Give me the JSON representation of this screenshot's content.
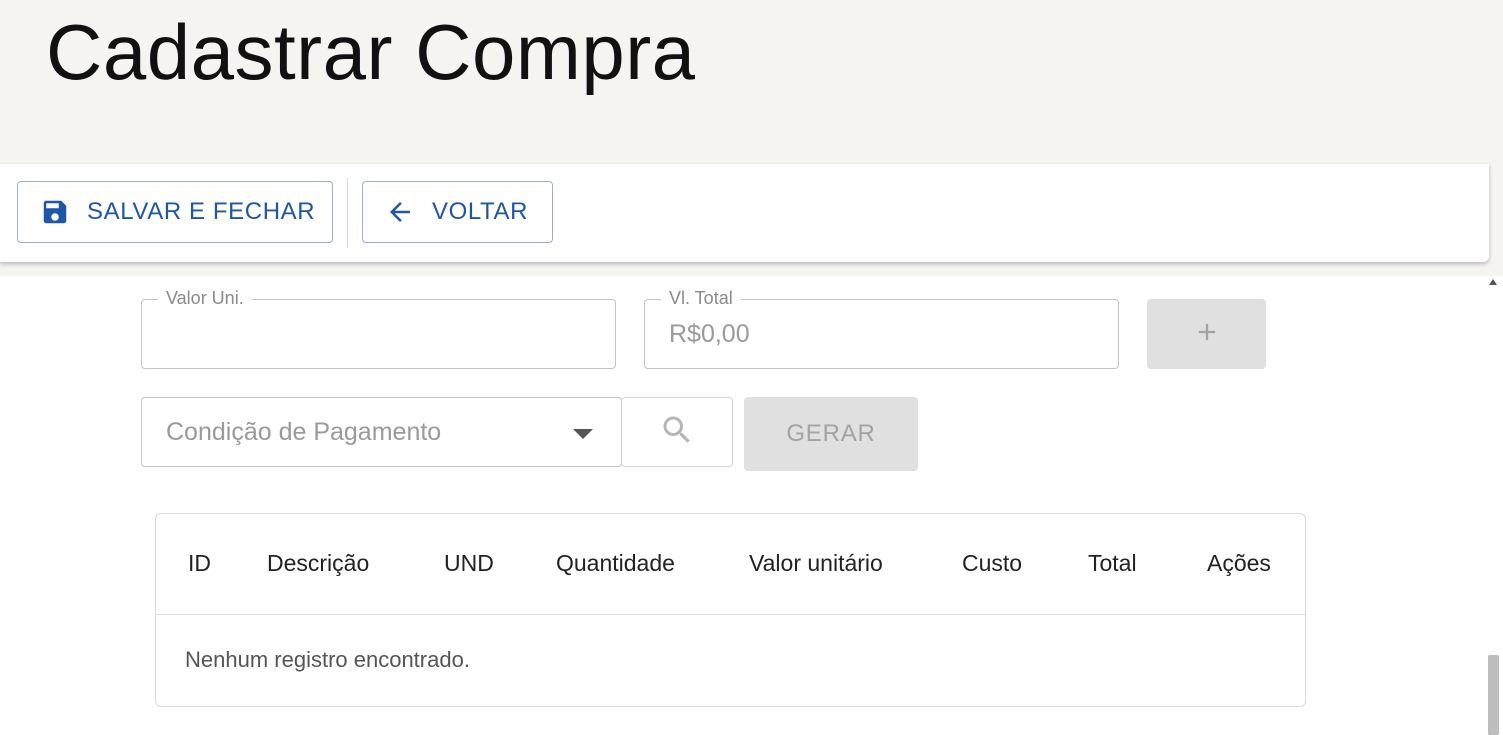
{
  "page": {
    "title": "Cadastrar Compra"
  },
  "toolbar": {
    "save_label": "SALVAR E FECHAR",
    "back_label": "VOLTAR"
  },
  "form": {
    "valor_uni": {
      "label": "Valor Uni.",
      "value": ""
    },
    "vl_total": {
      "label": "Vl. Total",
      "value": "R$0,00"
    },
    "add_icon": "plus-icon",
    "condicao": {
      "placeholder": "Condição de Pagamento"
    },
    "search_icon": "search-icon",
    "gerar_label": "GERAR"
  },
  "table": {
    "columns": [
      "ID",
      "Descrição",
      "UND",
      "Quantidade",
      "Valor unitário",
      "Custo",
      "Total",
      "Ações"
    ],
    "empty_message": "Nenhum registro encontrado."
  },
  "colors": {
    "accent": "#1f57a8",
    "background": "#f5f4f1",
    "disabled": "#e0e0e0"
  }
}
